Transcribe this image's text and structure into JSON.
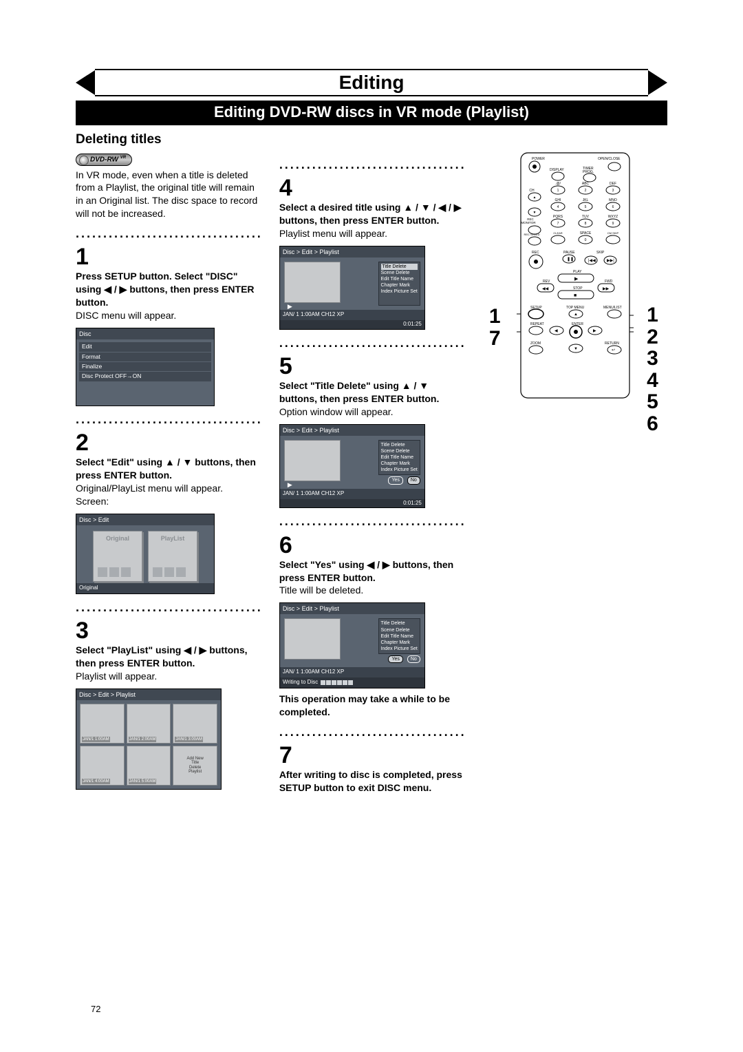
{
  "banner": {
    "title": "Editing"
  },
  "subbanner": {
    "title": "Editing DVD-RW discs in VR mode (Playlist)"
  },
  "section": {
    "title": "Deleting titles"
  },
  "badge": {
    "label": "DVD-RW",
    "mode": "VR"
  },
  "intro": "In VR mode, even when a title is deleted from a Playlist, the original title will remain in an Original list. The disc space to record will not be increased.",
  "dots": "··································",
  "step1": {
    "num": "1",
    "bold": "Press SETUP button. Select \"DISC\" using ◀ / ▶ buttons, then press ENTER button.",
    "text": "DISC menu will appear.",
    "fig": {
      "crumb": "Disc",
      "rows": [
        "Edit",
        "Format",
        "Finalize",
        "Disc Protect OFF→ON"
      ]
    }
  },
  "step2": {
    "num": "2",
    "bold": "Select \"Edit\" using ▲ / ▼ buttons, then press ENTER button.",
    "text": "Original/PlayList menu will appear.\nScreen:",
    "fig": {
      "crumb": "Disc > Edit",
      "original": "Original",
      "playlist": "PlayList",
      "footer": "Original"
    }
  },
  "step3": {
    "num": "3",
    "bold": "Select \"PlayList\" using ◀ / ▶ buttons, then press ENTER button.",
    "text": "Playlist will appear.",
    "fig": {
      "crumb": "Disc > Edit > Playlist",
      "tiles": [
        "JAN/1  1:00AM",
        "JAN/1  2:00AM",
        "JAN/1  3:00AM",
        "JAN/1  4:00AM",
        "JAN/1  5:00AM"
      ],
      "addnew": [
        "Add New",
        "Title",
        "Delete",
        "Playlist"
      ]
    }
  },
  "step4": {
    "num": "4",
    "bold": "Select a desired title using ▲ / ▼ / ◀ / ▶ buttons, then press ENTER button.",
    "text": "Playlist menu will appear.",
    "fig": {
      "crumb": "Disc > Edit > Playlist",
      "menu": [
        "Title Delete",
        "Scene Delete",
        "Edit Title Name",
        "Chapter Mark",
        "Index Picture Set"
      ],
      "highlight": 0,
      "footerL": "JAN/ 1   1:00AM  CH12     XP",
      "footerR": "0:01:25"
    }
  },
  "step5": {
    "num": "5",
    "bold": "Select \"Title Delete\" using ▲ / ▼ buttons, then press ENTER button.",
    "text": "Option window will appear.",
    "fig": {
      "crumb": "Disc > Edit > Playlist",
      "menu": [
        "Title Delete",
        "Scene Delete",
        "Edit Title Name",
        "Chapter Mark",
        "Index Picture Set"
      ],
      "yes": "Yes",
      "no": "No",
      "noSel": true,
      "footerL": "JAN/ 1   1:00AM  CH12     XP",
      "footerR": "0:01:25"
    }
  },
  "step6": {
    "num": "6",
    "bold": "Select \"Yes\" using ◀ / ▶ buttons, then press ENTER button.",
    "text": "Title will be deleted.",
    "fig": {
      "crumb": "Disc > Edit > Playlist",
      "menu": [
        "Title Delete",
        "Scene Delete",
        "Edit Title Name",
        "Chapter Mark",
        "Index Picture Set"
      ],
      "yes": "Yes",
      "no": "No",
      "yesSel": true,
      "footerL": "JAN/ 1   1:00AM  CH12     XP",
      "writing": "Writing to Disc"
    },
    "warn": "This operation may take a while to be completed."
  },
  "step7": {
    "num": "7",
    "bold": "After writing to disc is completed, press SETUP button to exit DISC menu."
  },
  "remote": {
    "labels_top": [
      "POWER",
      "OPEN/CLOSE",
      "DISPLAY",
      "TIMER PROG."
    ],
    "numpad": [
      {
        "n": "1",
        "t": ".@/"
      },
      {
        "n": "2",
        "t": "ABC"
      },
      {
        "n": "3",
        "t": "DEF"
      },
      {
        "n": "4",
        "t": "GHI"
      },
      {
        "n": "5",
        "t": "JKL"
      },
      {
        "n": "6",
        "t": "MNO"
      },
      {
        "n": "7",
        "t": "PQRS"
      },
      {
        "n": "8",
        "t": "TUV"
      },
      {
        "n": "9",
        "t": "WXYZ"
      },
      {
        "n": "",
        "t": "REC SPEED"
      },
      {
        "n": "0",
        "t": "SPACE"
      },
      {
        "n": "",
        "t": "CM SKIP"
      }
    ],
    "row_labels": [
      "CH",
      "REC MONITOR",
      "CLEAR"
    ],
    "rec": "REC",
    "pause": "PAUSE",
    "skip": "SKIP",
    "play": "PLAY",
    "rev": "REV",
    "fwd": "FWD",
    "stop": "STOP",
    "setup": "SETUP",
    "topmenu": "TOP MENU",
    "menulist": "MENU/LIST",
    "repeat": "REPEAT",
    "enter": "ENTER",
    "zoom": "ZOOM",
    "return": "RETURN"
  },
  "callouts": {
    "left": [
      "1",
      "7"
    ],
    "right": [
      "1",
      "2",
      "3",
      "4",
      "5",
      "6"
    ]
  },
  "page_num": "72"
}
